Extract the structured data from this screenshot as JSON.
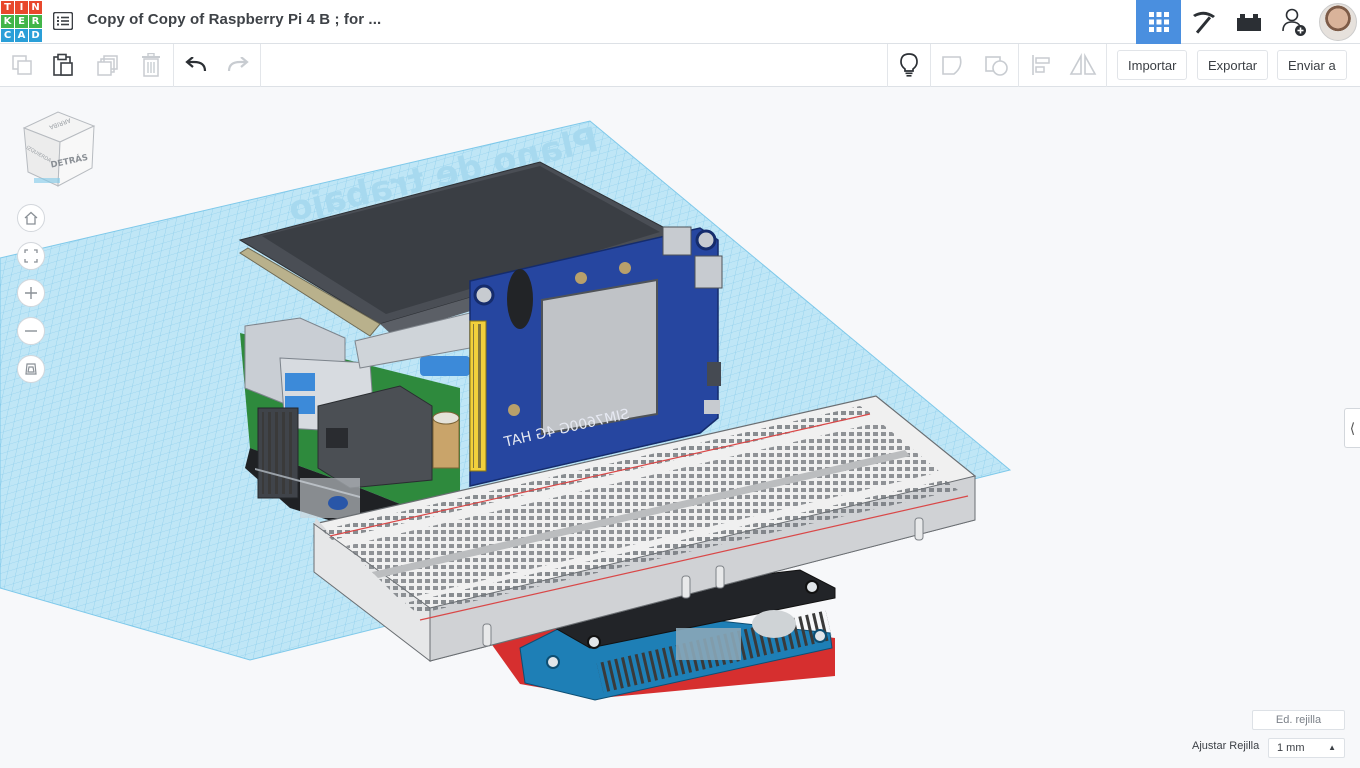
{
  "app": {
    "logo_letters": [
      "T",
      "I",
      "N",
      "K",
      "E",
      "R",
      "C",
      "A",
      "D"
    ],
    "logo_colors": [
      "#e8482c",
      "#e8482c",
      "#e8482c",
      "#41b549",
      "#41b549",
      "#41b549",
      "#2a9fd8",
      "#2a9fd8",
      "#2a9fd8"
    ],
    "title": "Copy of Copy of Raspberry Pi 4 B ; for ...",
    "accent": "#4a8fdf"
  },
  "header_right": {
    "items": [
      {
        "name": "3d-view-icon",
        "active": true
      },
      {
        "name": "pickaxe-icon",
        "active": false
      },
      {
        "name": "bricks-icon",
        "active": false
      },
      {
        "name": "add-user-icon",
        "active": false
      }
    ]
  },
  "toolbar": {
    "import_label": "Importar",
    "export_label": "Exportar",
    "send_label": "Enviar a"
  },
  "viewcube": {
    "front_label": "DETRÁS",
    "top_label": "ARRIBA",
    "side_label": "IZQUIERDA"
  },
  "workplane": {
    "label": "Plano de trabajo",
    "color": "#8fd0ee"
  },
  "models": {
    "hat_label": "SIM7600G 4G HAT"
  },
  "footer": {
    "edit_grid_label": "Ed. rejilla",
    "snap_label": "Ajustar Rejilla",
    "snap_value": "1 mm"
  }
}
